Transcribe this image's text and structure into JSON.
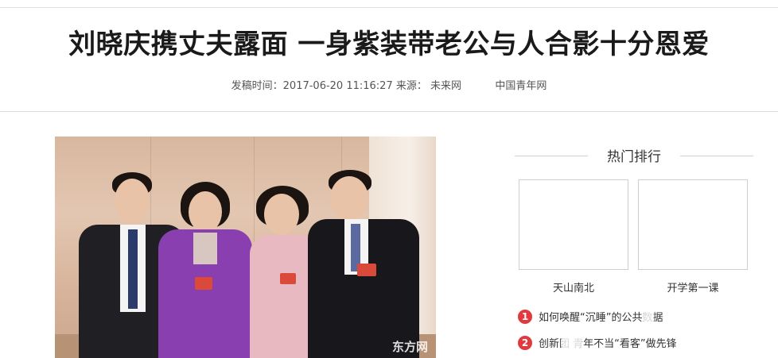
{
  "article": {
    "title": "刘晓庆携丈夫露面 一身紫装带老公与人合影十分恩爱",
    "meta": {
      "posted_label": "发稿时间：",
      "posted_time": "2017-06-20 11:16:27",
      "source_label": "来源：",
      "source_value": "未来网",
      "source_org": "中国青年网"
    },
    "photo": {
      "watermark": "东方网"
    }
  },
  "sidebar": {
    "title": "热门排行",
    "thumbs": [
      {
        "caption": "天山南北"
      },
      {
        "caption": "开学第一课"
      }
    ],
    "ranks": [
      {
        "num": "1",
        "text": "如何唤醒“沉睡”的公共数据"
      },
      {
        "num": "2",
        "text": "创新团 青年不当“看客”做先锋"
      }
    ]
  },
  "colors": {
    "rank_badge": "#e0393e",
    "divider": "#dcdcdc"
  }
}
